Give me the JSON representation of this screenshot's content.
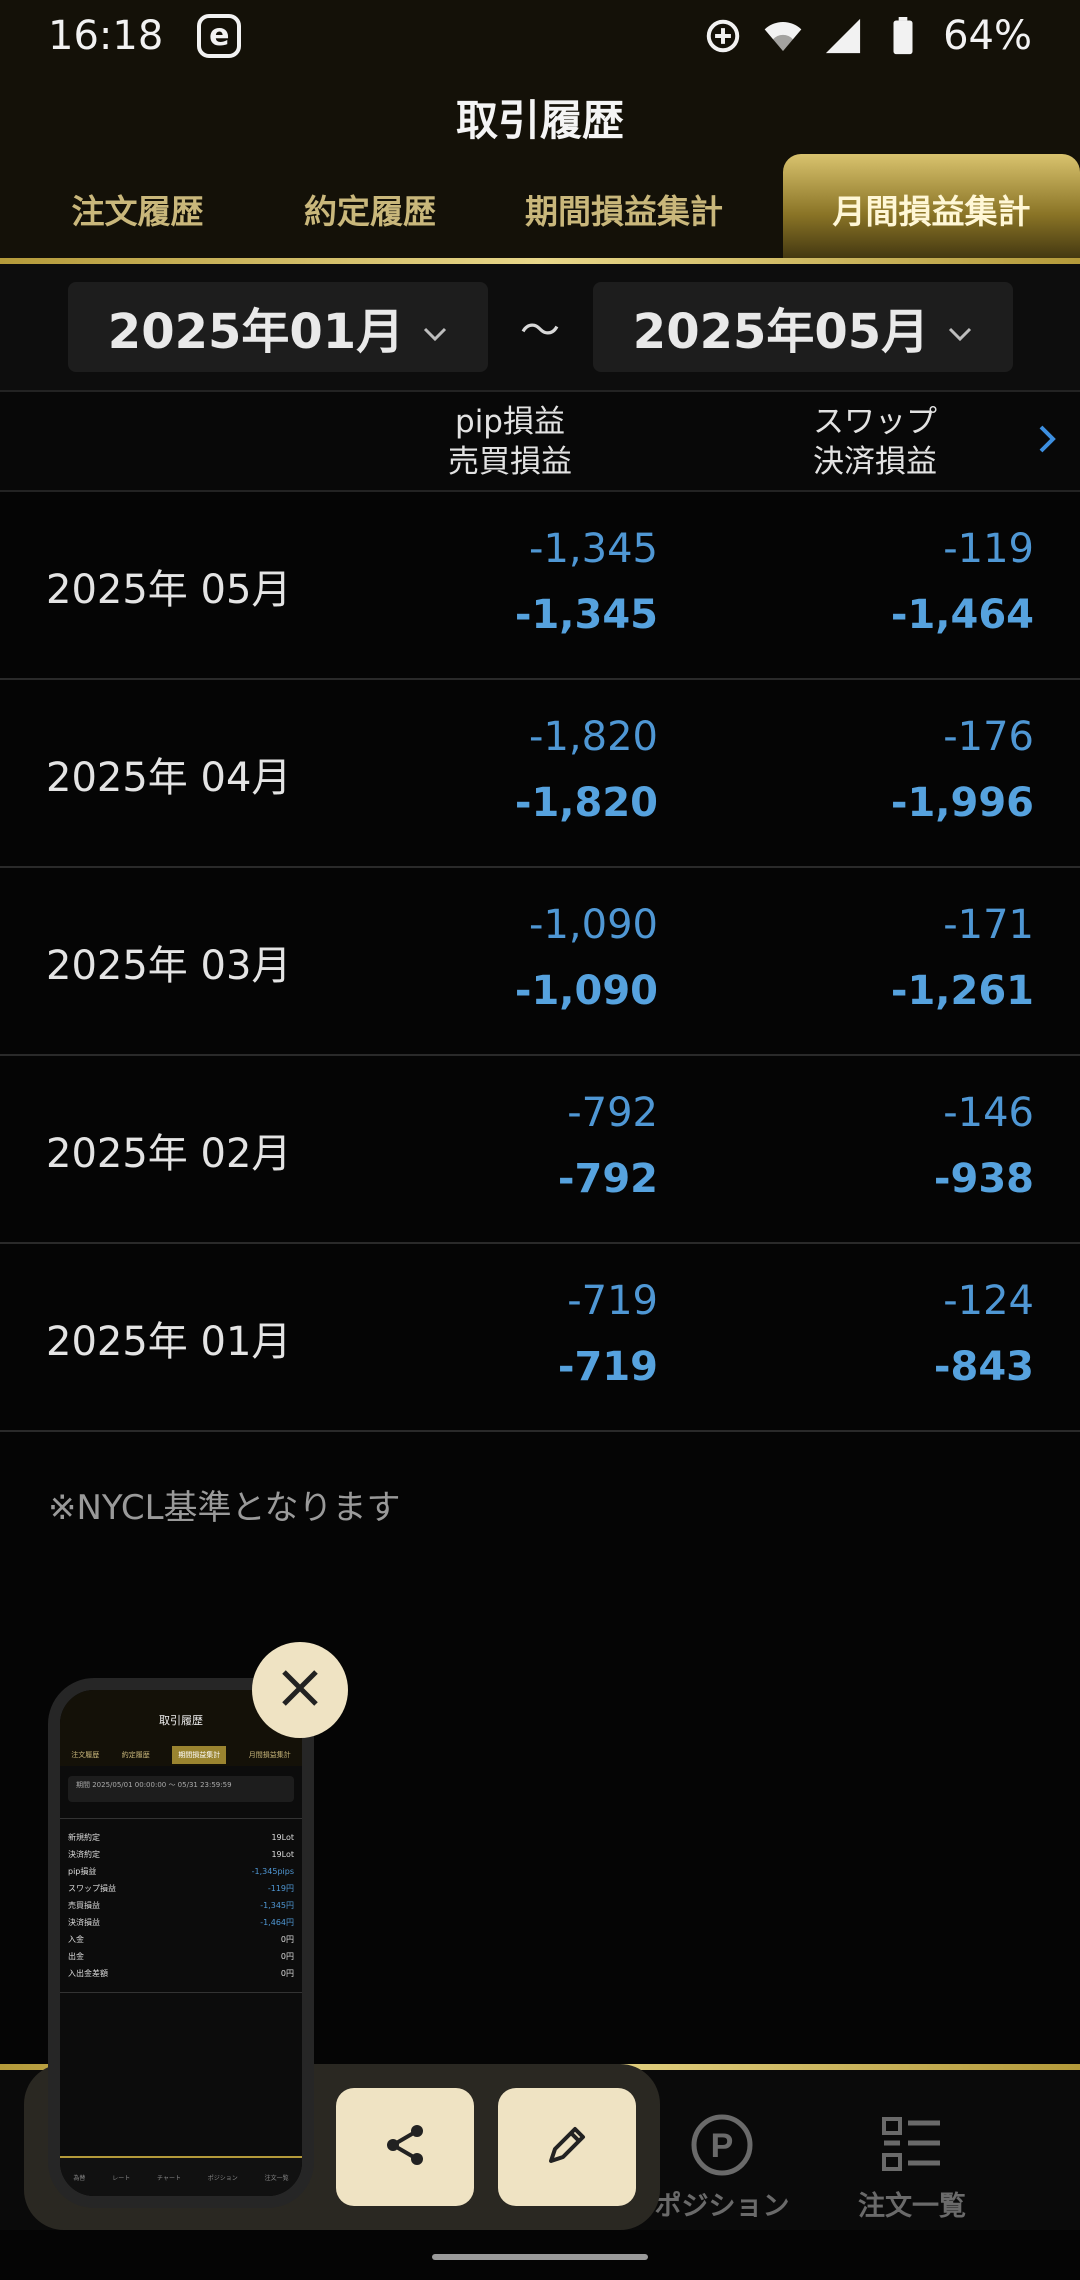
{
  "status_bar": {
    "time": "16:18",
    "app_badge": "e",
    "battery": "64%"
  },
  "header": {
    "title": "取引履歴"
  },
  "tabs": [
    {
      "label": "注文履歴",
      "active": false
    },
    {
      "label": "約定履歴",
      "active": false
    },
    {
      "label": "期間損益集計",
      "active": false
    },
    {
      "label": "月間損益集計",
      "active": true
    }
  ],
  "date_range": {
    "from": "2025年01月",
    "separator": "〜",
    "to": "2025年05月"
  },
  "columns": {
    "col1_line1": "pip損益",
    "col1_line2": "売買損益",
    "col2_line1": "スワップ",
    "col2_line2": "決済損益"
  },
  "rows": [
    {
      "month": "2025年 05月",
      "pip": "-1,345",
      "trade": "-1,345",
      "swap": "-119",
      "settle": "-1,464"
    },
    {
      "month": "2025年 04月",
      "pip": "-1,820",
      "trade": "-1,820",
      "swap": "-176",
      "settle": "-1,996"
    },
    {
      "month": "2025年 03月",
      "pip": "-1,090",
      "trade": "-1,090",
      "swap": "-171",
      "settle": "-1,261"
    },
    {
      "month": "2025年 02月",
      "pip": "-792",
      "trade": "-792",
      "swap": "-146",
      "settle": "-938"
    },
    {
      "month": "2025年 01月",
      "pip": "-719",
      "trade": "-719",
      "swap": "-124",
      "settle": "-843"
    }
  ],
  "note": "※NYCL基準となります",
  "bottom_nav": {
    "positions_label": "ポジション",
    "orders_label": "注文一覧"
  },
  "preview": {
    "title": "取引履歴",
    "tabs": [
      "注文履歴",
      "約定履歴",
      "期間損益集計",
      "月間損益集計"
    ],
    "search": "期間 2025/05/01 00:00:00 ～ 05/31 23:59:59",
    "items": [
      {
        "label": "新規約定",
        "value": "19Lot"
      },
      {
        "label": "決済約定",
        "value": "19Lot"
      },
      {
        "label": "pip損益",
        "value": "-1,345pips"
      },
      {
        "label": "スワップ損益",
        "value": "-119円"
      },
      {
        "label": "売買損益",
        "value": "-1,345円"
      },
      {
        "label": "決済損益",
        "value": "-1,464円"
      },
      {
        "label": "入金",
        "value": "0円"
      },
      {
        "label": "出金",
        "value": "0円"
      },
      {
        "label": "入出金差額",
        "value": "0円"
      }
    ],
    "nav": [
      "為替",
      "レート",
      "チャート",
      "ポジション",
      "注文一覧"
    ]
  }
}
